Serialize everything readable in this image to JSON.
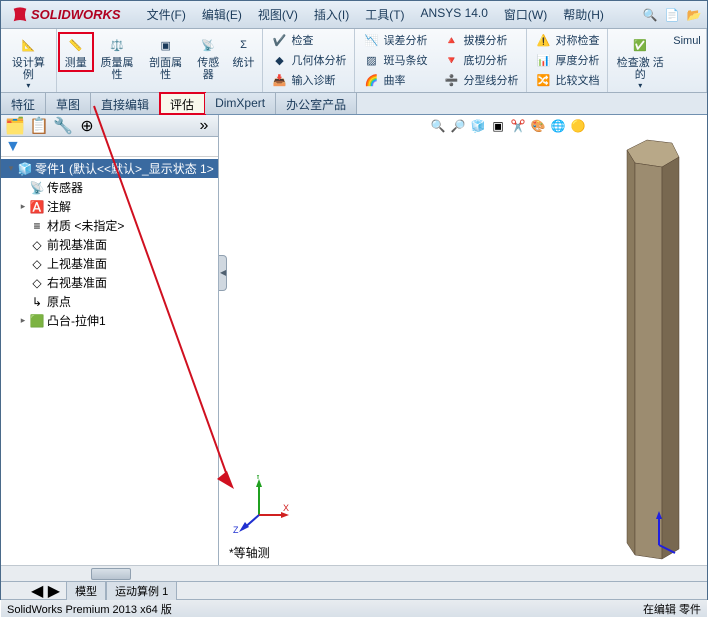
{
  "app": {
    "name": "SOLIDWORKS"
  },
  "menu": {
    "file": "文件(F)",
    "edit": "编辑(E)",
    "view": "视图(V)",
    "insert": "插入(I)",
    "tools": "工具(T)",
    "ansys": "ANSYS 14.0",
    "window": "窗口(W)",
    "help": "帮助(H)"
  },
  "ribbon": {
    "design_study": "设计算\n例",
    "measure": "测量",
    "mass_props": "质量属\n性",
    "section_props": "剖面属\n性",
    "sensor": "传感器",
    "statistics": "统计",
    "check": "检查",
    "geometry": "几何体分析",
    "input_diag": "输入诊断",
    "deviation": "误差分析",
    "zebra": "斑马条纹",
    "curvature": "曲率",
    "draft": "拔模分析",
    "undercut": "底切分析",
    "parting": "分型线分析",
    "symmetry": "对称检查",
    "thickness": "厚度分析",
    "compare": "比较文档",
    "check_active": "检查激\n活的",
    "simul": "Simul"
  },
  "tabs": {
    "feature": "特征",
    "sketch": "草图",
    "direct_edit": "直接编辑",
    "evaluate": "评估",
    "dimxpert": "DimXpert",
    "office": "办公室产品"
  },
  "tree": {
    "root": "零件1  (默认<<默认>_显示状态 1>",
    "sensors": "传感器",
    "annotations": "注解",
    "material": "材质 <未指定>",
    "front_plane": "前视基准面",
    "top_plane": "上视基准面",
    "right_plane": "右视基准面",
    "origin": "原点",
    "extrude": "凸台-拉伸1"
  },
  "viewport": {
    "label": "*等轴测"
  },
  "bottom_tabs": {
    "model": "模型",
    "motion": "运动算例 1"
  },
  "status": {
    "version": "SolidWorks Premium 2013 x64 版",
    "state": "在编辑 零件"
  }
}
